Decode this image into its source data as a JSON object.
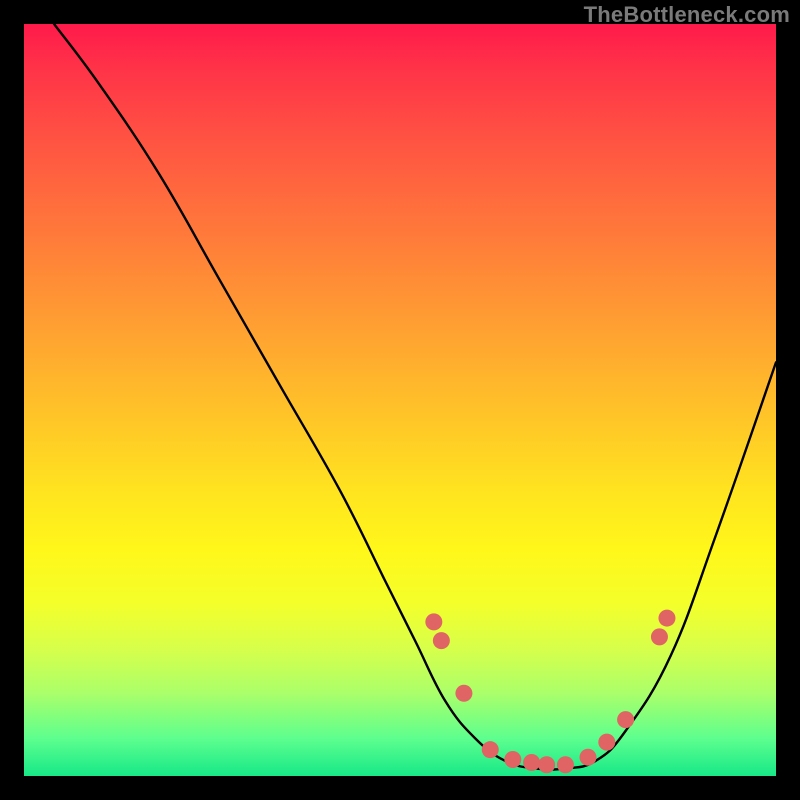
{
  "watermark": "TheBottleneck.com",
  "colors": {
    "background": "#000000",
    "gradient_top": "#ff1a4b",
    "gradient_bottom": "#17e888",
    "curve": "#000000",
    "dots": "#e06464",
    "watermark": "#7a7a7a"
  },
  "chart_data": {
    "type": "line",
    "title": "",
    "xlabel": "",
    "ylabel": "",
    "xlim": [
      0,
      100
    ],
    "ylim": [
      0,
      100
    ],
    "grid": false,
    "legend": false,
    "series": [
      {
        "name": "bottleneck-curve",
        "x": [
          4,
          10,
          18,
          26,
          34,
          42,
          48,
          52,
          56,
          60,
          64,
          68,
          72,
          76,
          80,
          86,
          92,
          100
        ],
        "y": [
          100,
          92,
          80,
          66,
          52,
          38,
          26,
          18,
          10,
          5,
          2,
          1,
          1,
          2,
          6,
          16,
          32,
          55
        ]
      }
    ],
    "markers": [
      {
        "x": 54.5,
        "y": 20.5
      },
      {
        "x": 55.5,
        "y": 18.0
      },
      {
        "x": 58.5,
        "y": 11.0
      },
      {
        "x": 62.0,
        "y": 3.5
      },
      {
        "x": 65.0,
        "y": 2.2
      },
      {
        "x": 67.5,
        "y": 1.8
      },
      {
        "x": 69.5,
        "y": 1.5
      },
      {
        "x": 72.0,
        "y": 1.5
      },
      {
        "x": 75.0,
        "y": 2.5
      },
      {
        "x": 77.5,
        "y": 4.5
      },
      {
        "x": 80.0,
        "y": 7.5
      },
      {
        "x": 84.5,
        "y": 18.5
      },
      {
        "x": 85.5,
        "y": 21.0
      }
    ]
  }
}
